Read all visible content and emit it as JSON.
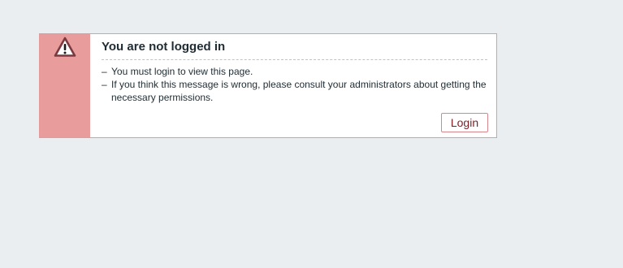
{
  "message": {
    "title": "You are not logged in",
    "details": [
      "You must login to view this page.",
      "If you think this message is wrong, please consult your administrators about getting the necessary permissions."
    ],
    "login_label": "Login",
    "icon": "warning-icon"
  },
  "colors": {
    "page_background": "#ebeef0",
    "side_bar": "#e89c9b",
    "border": "#e49a9a",
    "button_text": "#7b1e25"
  }
}
